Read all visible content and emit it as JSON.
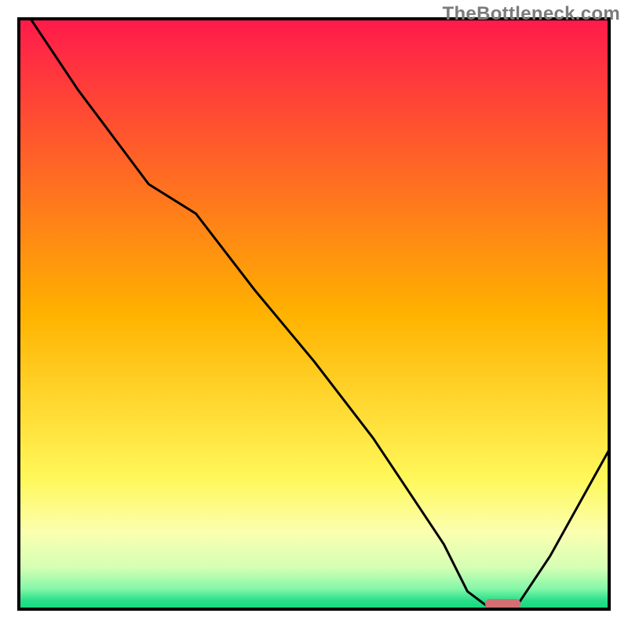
{
  "watermark": {
    "text": "TheBottleneck.com"
  },
  "colors": {
    "curve": "#000000",
    "frame": "#000000",
    "marker": "#d36f72",
    "watermark": "#7b7b7b"
  },
  "gradient_stops": [
    {
      "offset": 0.0,
      "color": "#ff1a4b"
    },
    {
      "offset": 0.5,
      "color": "#ffb200"
    },
    {
      "offset": 0.78,
      "color": "#fff85a"
    },
    {
      "offset": 0.87,
      "color": "#fbffb0"
    },
    {
      "offset": 0.93,
      "color": "#d4ffb5"
    },
    {
      "offset": 0.965,
      "color": "#85f7a8"
    },
    {
      "offset": 0.985,
      "color": "#29e08a"
    },
    {
      "offset": 1.0,
      "color": "#15d67e"
    }
  ],
  "chart_data": {
    "type": "line",
    "title": "",
    "xlabel": "",
    "ylabel": "",
    "xlim": [
      0,
      100
    ],
    "ylim": [
      0,
      100
    ],
    "legend": false,
    "grid": false,
    "series": [
      {
        "name": "bottleneck-curve",
        "x": [
          2,
          10,
          22,
          30,
          40,
          50,
          60,
          68,
          72,
          76,
          80,
          84,
          90,
          100
        ],
        "values": [
          100,
          88,
          72,
          67,
          54,
          42,
          29,
          17,
          11,
          3,
          0,
          0,
          9,
          27
        ]
      }
    ],
    "marker": {
      "x_center": 82,
      "x_halfwidth": 3,
      "y": 0
    },
    "note": "x/y are percent of plot interior; curve is the black dip line, marker is the pink capsule at the trough"
  }
}
